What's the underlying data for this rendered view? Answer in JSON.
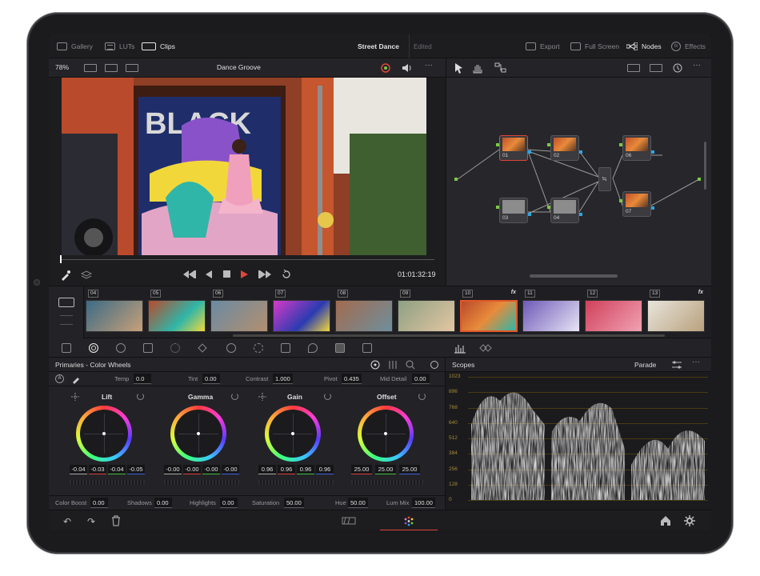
{
  "topbar": {
    "gallery": "Gallery",
    "luts": "LUTs",
    "clips": "Clips",
    "project_title": "Street Dance",
    "status": "Edited",
    "export": "Export",
    "full_screen": "Full Screen",
    "nodes": "Nodes",
    "effects": "Effects"
  },
  "viewer": {
    "zoom": "78%",
    "clip_name": "Dance Groove",
    "timecode": "01:01:32:19",
    "playhead": 0.0
  },
  "nodes": [
    {
      "label": "01"
    },
    {
      "label": "02"
    },
    {
      "label": "03"
    },
    {
      "label": "04"
    },
    {
      "label": "06"
    },
    {
      "label": "07"
    }
  ],
  "clips": [
    {
      "num": "04",
      "fx": ""
    },
    {
      "num": "05",
      "fx": ""
    },
    {
      "num": "06",
      "fx": ""
    },
    {
      "num": "07",
      "fx": ""
    },
    {
      "num": "08",
      "fx": ""
    },
    {
      "num": "09",
      "fx": ""
    },
    {
      "num": "10",
      "fx": "fx"
    },
    {
      "num": "11",
      "fx": ""
    },
    {
      "num": "12",
      "fx": ""
    },
    {
      "num": "13",
      "fx": "fx"
    }
  ],
  "primaries": {
    "title": "Primaries - Color Wheels",
    "temp_label": "Temp",
    "temp": "0.0",
    "tint_label": "Tint",
    "tint": "0.00",
    "contrast_label": "Contrast",
    "contrast": "1.000",
    "pivot_label": "Pivot",
    "pivot": "0.435",
    "mid_detail_label": "Mid Detail",
    "mid_detail": "0.00",
    "wheels": [
      {
        "name": "Lift",
        "values": [
          "-0.04",
          "-0.03",
          "-0.04",
          "-0.05"
        ]
      },
      {
        "name": "Gamma",
        "values": [
          "-0.00",
          "-0.00",
          "-0.00",
          "-0.00"
        ]
      },
      {
        "name": "Gain",
        "values": [
          "0.96",
          "0.96",
          "0.96",
          "0.96"
        ]
      },
      {
        "name": "Offset",
        "values": [
          "25.00",
          "25.00",
          "25.00"
        ]
      }
    ],
    "color_boost_label": "Color Boost",
    "color_boost": "0.00",
    "shadows_label": "Shadows",
    "shadows": "0.00",
    "highlights_label": "Highlights",
    "highlights": "0.00",
    "saturation_label": "Saturation",
    "saturation": "50.00",
    "hue_label": "Hue",
    "hue": "50.00",
    "lum_mix_label": "Lum Mix",
    "lum_mix": "100.00"
  },
  "scopes": {
    "title": "Scopes",
    "mode": "Parade",
    "ticks": [
      "1023",
      "896",
      "768",
      "640",
      "512",
      "384",
      "256",
      "128",
      "0"
    ]
  },
  "colors": {
    "accent": "#e0463a",
    "node_in": "#7ac943",
    "node_out": "#2aa7e0"
  }
}
